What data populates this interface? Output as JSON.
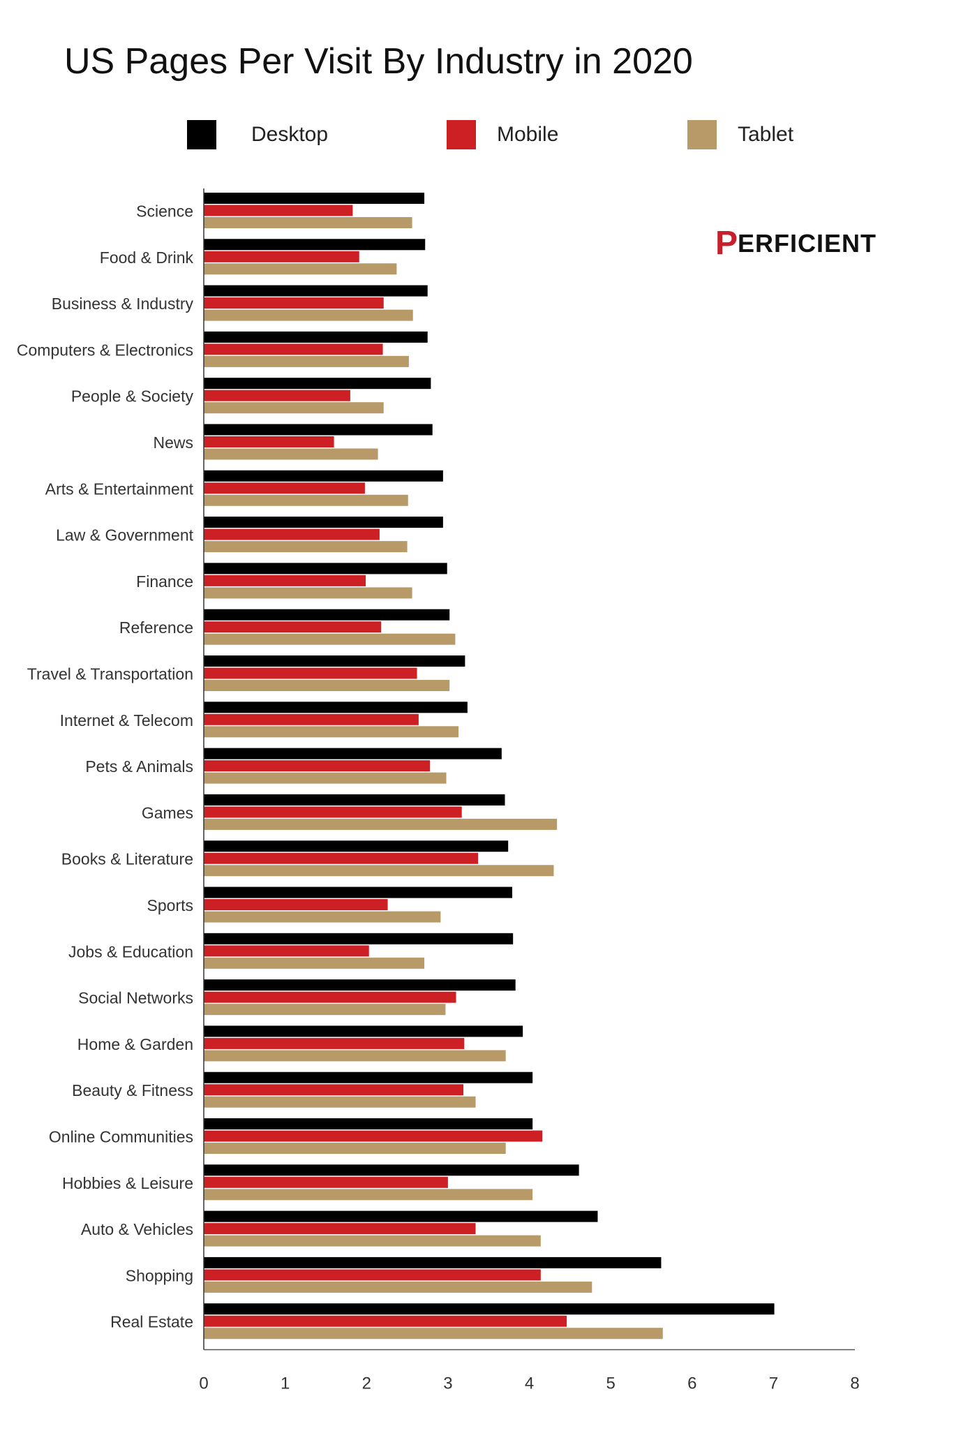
{
  "chart_data": {
    "type": "bar",
    "orientation": "horizontal",
    "title": "US Pages Per Visit By Industry in 2020",
    "xlabel": "",
    "ylabel": "",
    "xlim": [
      0,
      8
    ],
    "xticks": [
      0,
      1,
      2,
      3,
      4,
      5,
      6,
      7,
      8
    ],
    "grid": false,
    "legend_position": "top",
    "categories": [
      "Science",
      "Food & Drink",
      "Business & Industry",
      "Computers & Electronics",
      "People & Society",
      "News",
      "Arts & Entertainment",
      "Law & Government",
      "Finance",
      "Reference",
      "Travel & Transportation",
      "Internet & Telecom",
      "Pets & Animals",
      "Games",
      "Books & Literature",
      "Sports",
      "Jobs & Education",
      "Social Networks",
      "Home & Garden",
      "Beauty & Fitness",
      "Online Communities",
      "Hobbies & Leisure",
      "Auto & Vehicles",
      "Shopping",
      "Real Estate"
    ],
    "series": [
      {
        "name": "Desktop",
        "color": "#000000",
        "values": [
          2.71,
          2.72,
          2.75,
          2.75,
          2.79,
          2.81,
          2.94,
          2.94,
          2.99,
          3.02,
          3.21,
          3.24,
          3.66,
          3.7,
          3.74,
          3.79,
          3.8,
          3.83,
          3.92,
          4.04,
          4.04,
          4.61,
          4.84,
          5.62,
          7.01
        ]
      },
      {
        "name": "Mobile",
        "color": "#cc2024",
        "values": [
          1.83,
          1.91,
          2.21,
          2.2,
          1.8,
          1.6,
          1.98,
          2.16,
          1.99,
          2.18,
          2.62,
          2.64,
          2.78,
          3.17,
          3.37,
          2.26,
          2.03,
          3.1,
          3.2,
          3.19,
          4.16,
          3.0,
          3.34,
          4.14,
          4.46
        ]
      },
      {
        "name": "Tablet",
        "color": "#b89968",
        "values": [
          2.56,
          2.37,
          2.57,
          2.52,
          2.21,
          2.14,
          2.51,
          2.5,
          2.56,
          3.09,
          3.02,
          3.13,
          2.98,
          4.34,
          4.3,
          2.91,
          2.71,
          2.97,
          3.71,
          3.34,
          3.71,
          4.04,
          4.14,
          4.77,
          5.64
        ]
      }
    ]
  },
  "logo": {
    "mark": "P",
    "text": "ERFICIENT"
  }
}
